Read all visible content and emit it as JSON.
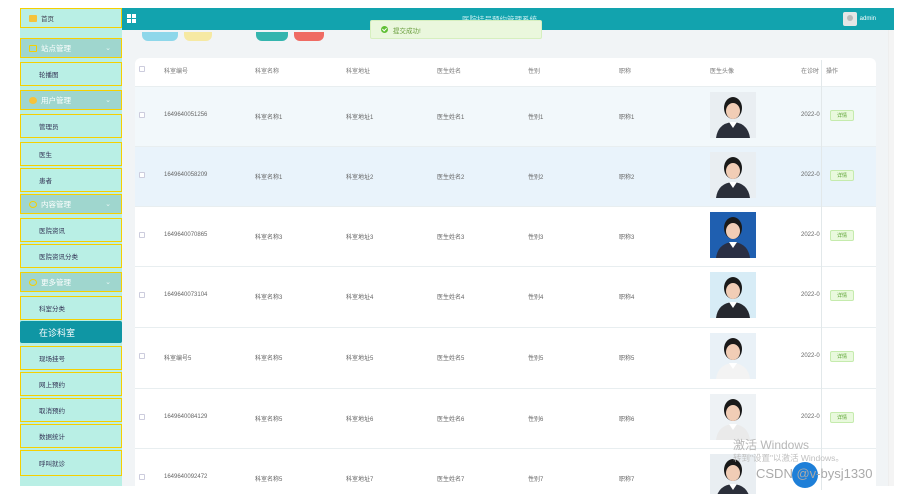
{
  "sidebar": {
    "home": "首页",
    "groups": [
      "站点管理",
      "用户管理",
      "内容管理",
      "更多管理"
    ],
    "items": {
      "site": [
        "轮播图"
      ],
      "user": [
        "管理员",
        "医生",
        "患者"
      ],
      "content": [
        "医院资讯",
        "医院资讯分类"
      ],
      "more": [
        "科室分类",
        "在诊科室",
        "现场挂号",
        "网上预约",
        "取消预约",
        "数据统计",
        "呼叫就诊"
      ]
    }
  },
  "topbar": {
    "title": "医院挂号预约管理系统",
    "user": "admin"
  },
  "toast": {
    "message": "提交成功!"
  },
  "table": {
    "headers": [
      "科室编号",
      "科室名称",
      "科室地址",
      "医生姓名",
      "性别",
      "职称",
      "医生头像",
      "在诊时",
      "操作"
    ],
    "rows": [
      {
        "id": "1649640051256",
        "name": "科室名称1",
        "addr": "科室地址1",
        "doctor": "医生姓名1",
        "gender": "性别1",
        "title": "职称1",
        "time": "2022-0"
      },
      {
        "id": "1649640058209",
        "name": "科室名称1",
        "addr": "科室地址2",
        "doctor": "医生姓名2",
        "gender": "性别2",
        "title": "职称2",
        "time": "2022-0"
      },
      {
        "id": "1649640070865",
        "name": "科室名称3",
        "addr": "科室地址3",
        "doctor": "医生姓名3",
        "gender": "性别3",
        "title": "职称3",
        "time": "2022-0"
      },
      {
        "id": "1649640073104",
        "name": "科室名称3",
        "addr": "科室地址4",
        "doctor": "医生姓名4",
        "gender": "性别4",
        "title": "职称4",
        "time": "2022-0"
      },
      {
        "id": "科室编号5",
        "name": "科室名称5",
        "addr": "科室地址5",
        "doctor": "医生姓名5",
        "gender": "性别5",
        "title": "职称5",
        "time": "2022-0"
      },
      {
        "id": "1649640084129",
        "name": "科室名称5",
        "addr": "科室地址6",
        "doctor": "医生姓名6",
        "gender": "性别6",
        "title": "职称6",
        "time": "2022-0"
      },
      {
        "id": "1649640092472",
        "name": "科室名称5",
        "addr": "科室地址7",
        "doctor": "医生姓名7",
        "gender": "性别7",
        "title": "职称7",
        "time": ""
      }
    ],
    "action": "详情"
  },
  "watermark": {
    "line1": "激活 Windows",
    "line2": "转到\"设置\"以激活 Windows。",
    "csdn": "CSDN @v-bysj1330"
  },
  "colors": {
    "topbar": "#12a3ae",
    "sidebar": "#b9efe5",
    "active": "#0f96a4",
    "border": "#f5d000"
  }
}
